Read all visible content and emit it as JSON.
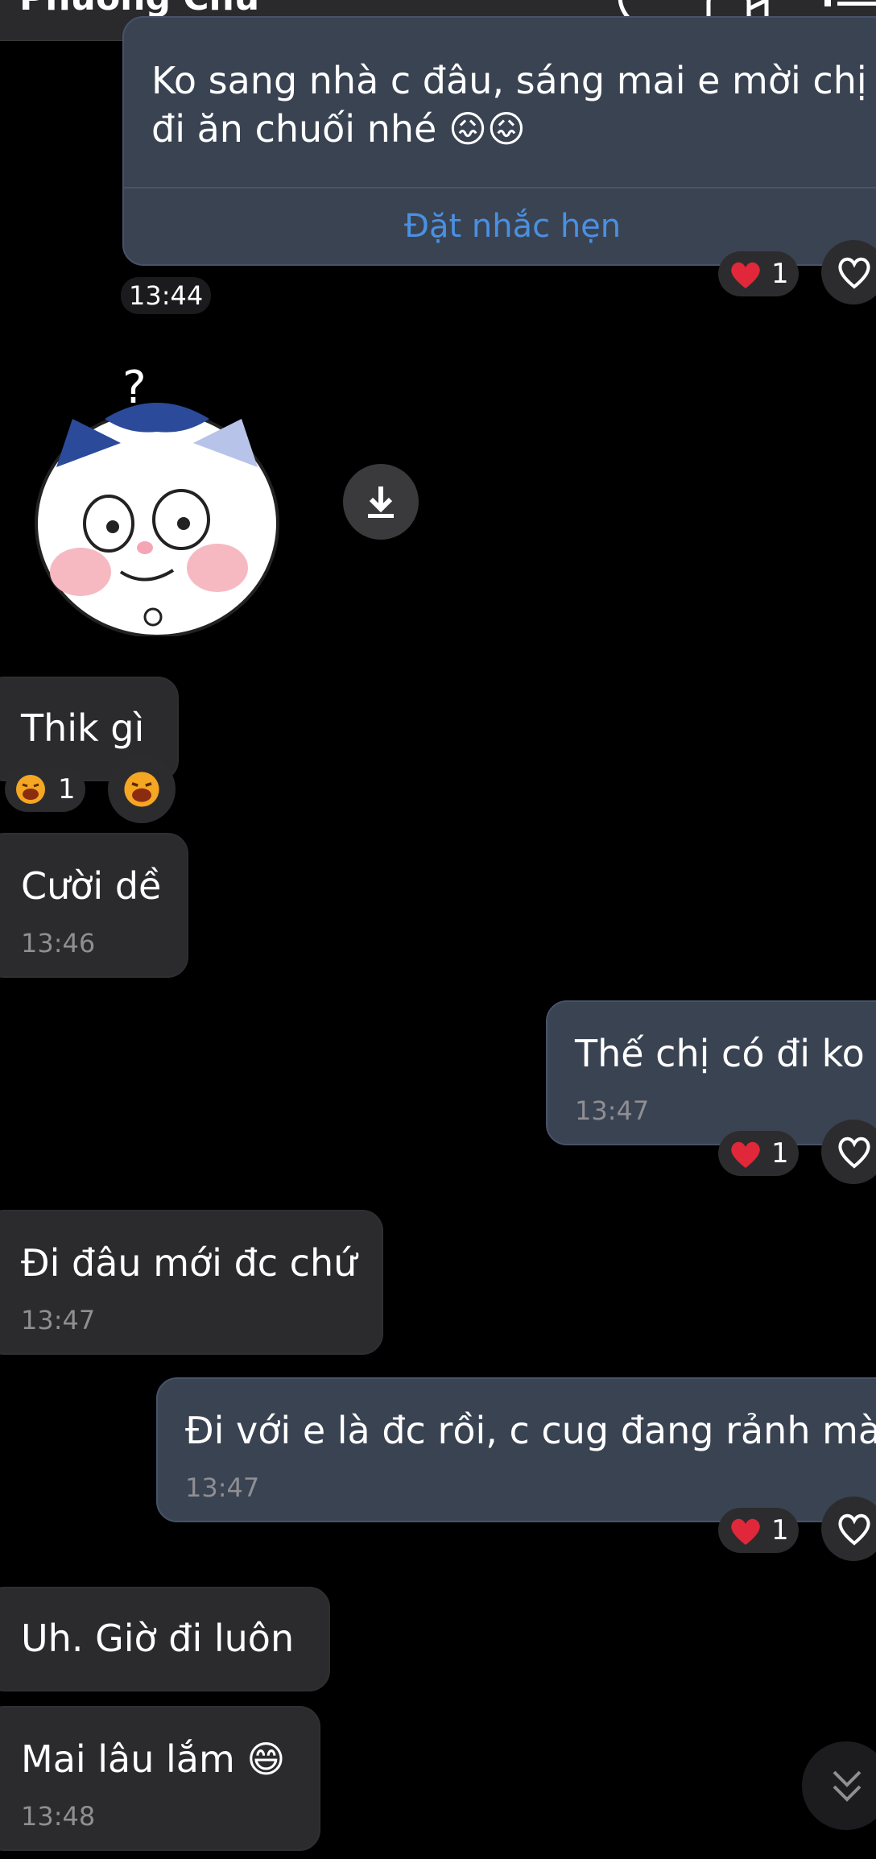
{
  "header": {
    "contact_name": "Phương Chu"
  },
  "messages": {
    "m1": {
      "text_line1": "Ko sang nhà c đâu, sáng mai e mời chị",
      "text_line2": "đi ăn chuối nhé 😖😖",
      "action": "Đặt nhắc hẹn",
      "time": "13:44",
      "reaction_count": "1"
    },
    "m2": {
      "text": "Thik gì",
      "reaction_count": "1"
    },
    "m3": {
      "text": "Cười dề",
      "time": "13:46"
    },
    "m4": {
      "text": "Thế chị có đi ko",
      "time": "13:47",
      "reaction_count": "1"
    },
    "m5": {
      "text": "Đi đâu mới đc chứ",
      "time": "13:47"
    },
    "m6": {
      "text": "Đi với e là đc rồi, c cug đang rảnh mà",
      "time": "13:47",
      "reaction_count": "1"
    },
    "m7": {
      "text": "Uh. Giờ đi luôn"
    },
    "m8": {
      "text": "Mai lâu lắm 😄",
      "time": "13:48"
    }
  },
  "icons": [
    "phone-icon",
    "video-icon",
    "menu-icon",
    "heart-icon",
    "laugh-emoji-icon",
    "download-icon",
    "chevron-double-down-icon"
  ],
  "colors": {
    "background": "#000000",
    "incoming_bubble": "#2b2b2d",
    "outgoing_bubble": "#3a4352",
    "link": "#4a90e2",
    "heart": "#e0283a"
  }
}
